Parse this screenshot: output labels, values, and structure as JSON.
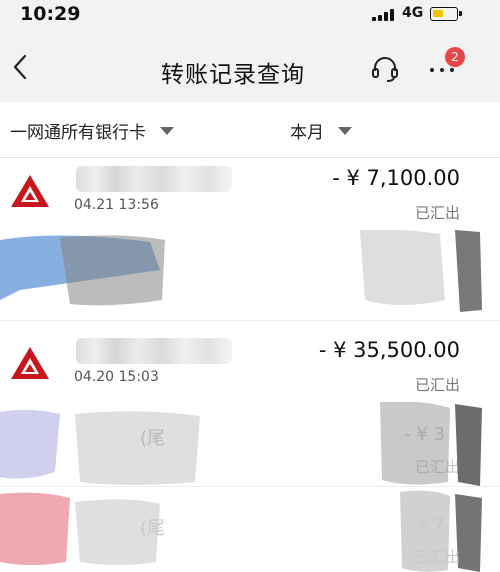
{
  "status_bar": {
    "time": "10:29",
    "network": "4G"
  },
  "nav": {
    "title": "转账记录查询",
    "notification_count": "2"
  },
  "filters": {
    "bank_label": "一网通所有银行卡",
    "period_label": "本月"
  },
  "records": [
    {
      "time": "04.21 13:56",
      "amount": "- ¥ 7,100.00",
      "status": "已汇出"
    },
    {
      "time": "04.20 15:03",
      "amount": "- ¥ 35,500.00",
      "status": "已汇出"
    }
  ],
  "partial_records": [
    {
      "name_fragment": "(尾",
      "amount_fragment": "- ¥ 3",
      "status": "已汇出"
    },
    {
      "name_fragment": "(尾",
      "amount_fragment": "- ¥ 7",
      "status": "已汇出"
    }
  ],
  "colors": {
    "brand_red": "#c8161d",
    "badge": "#e8474a",
    "header_bg": "#f2f2f2"
  }
}
